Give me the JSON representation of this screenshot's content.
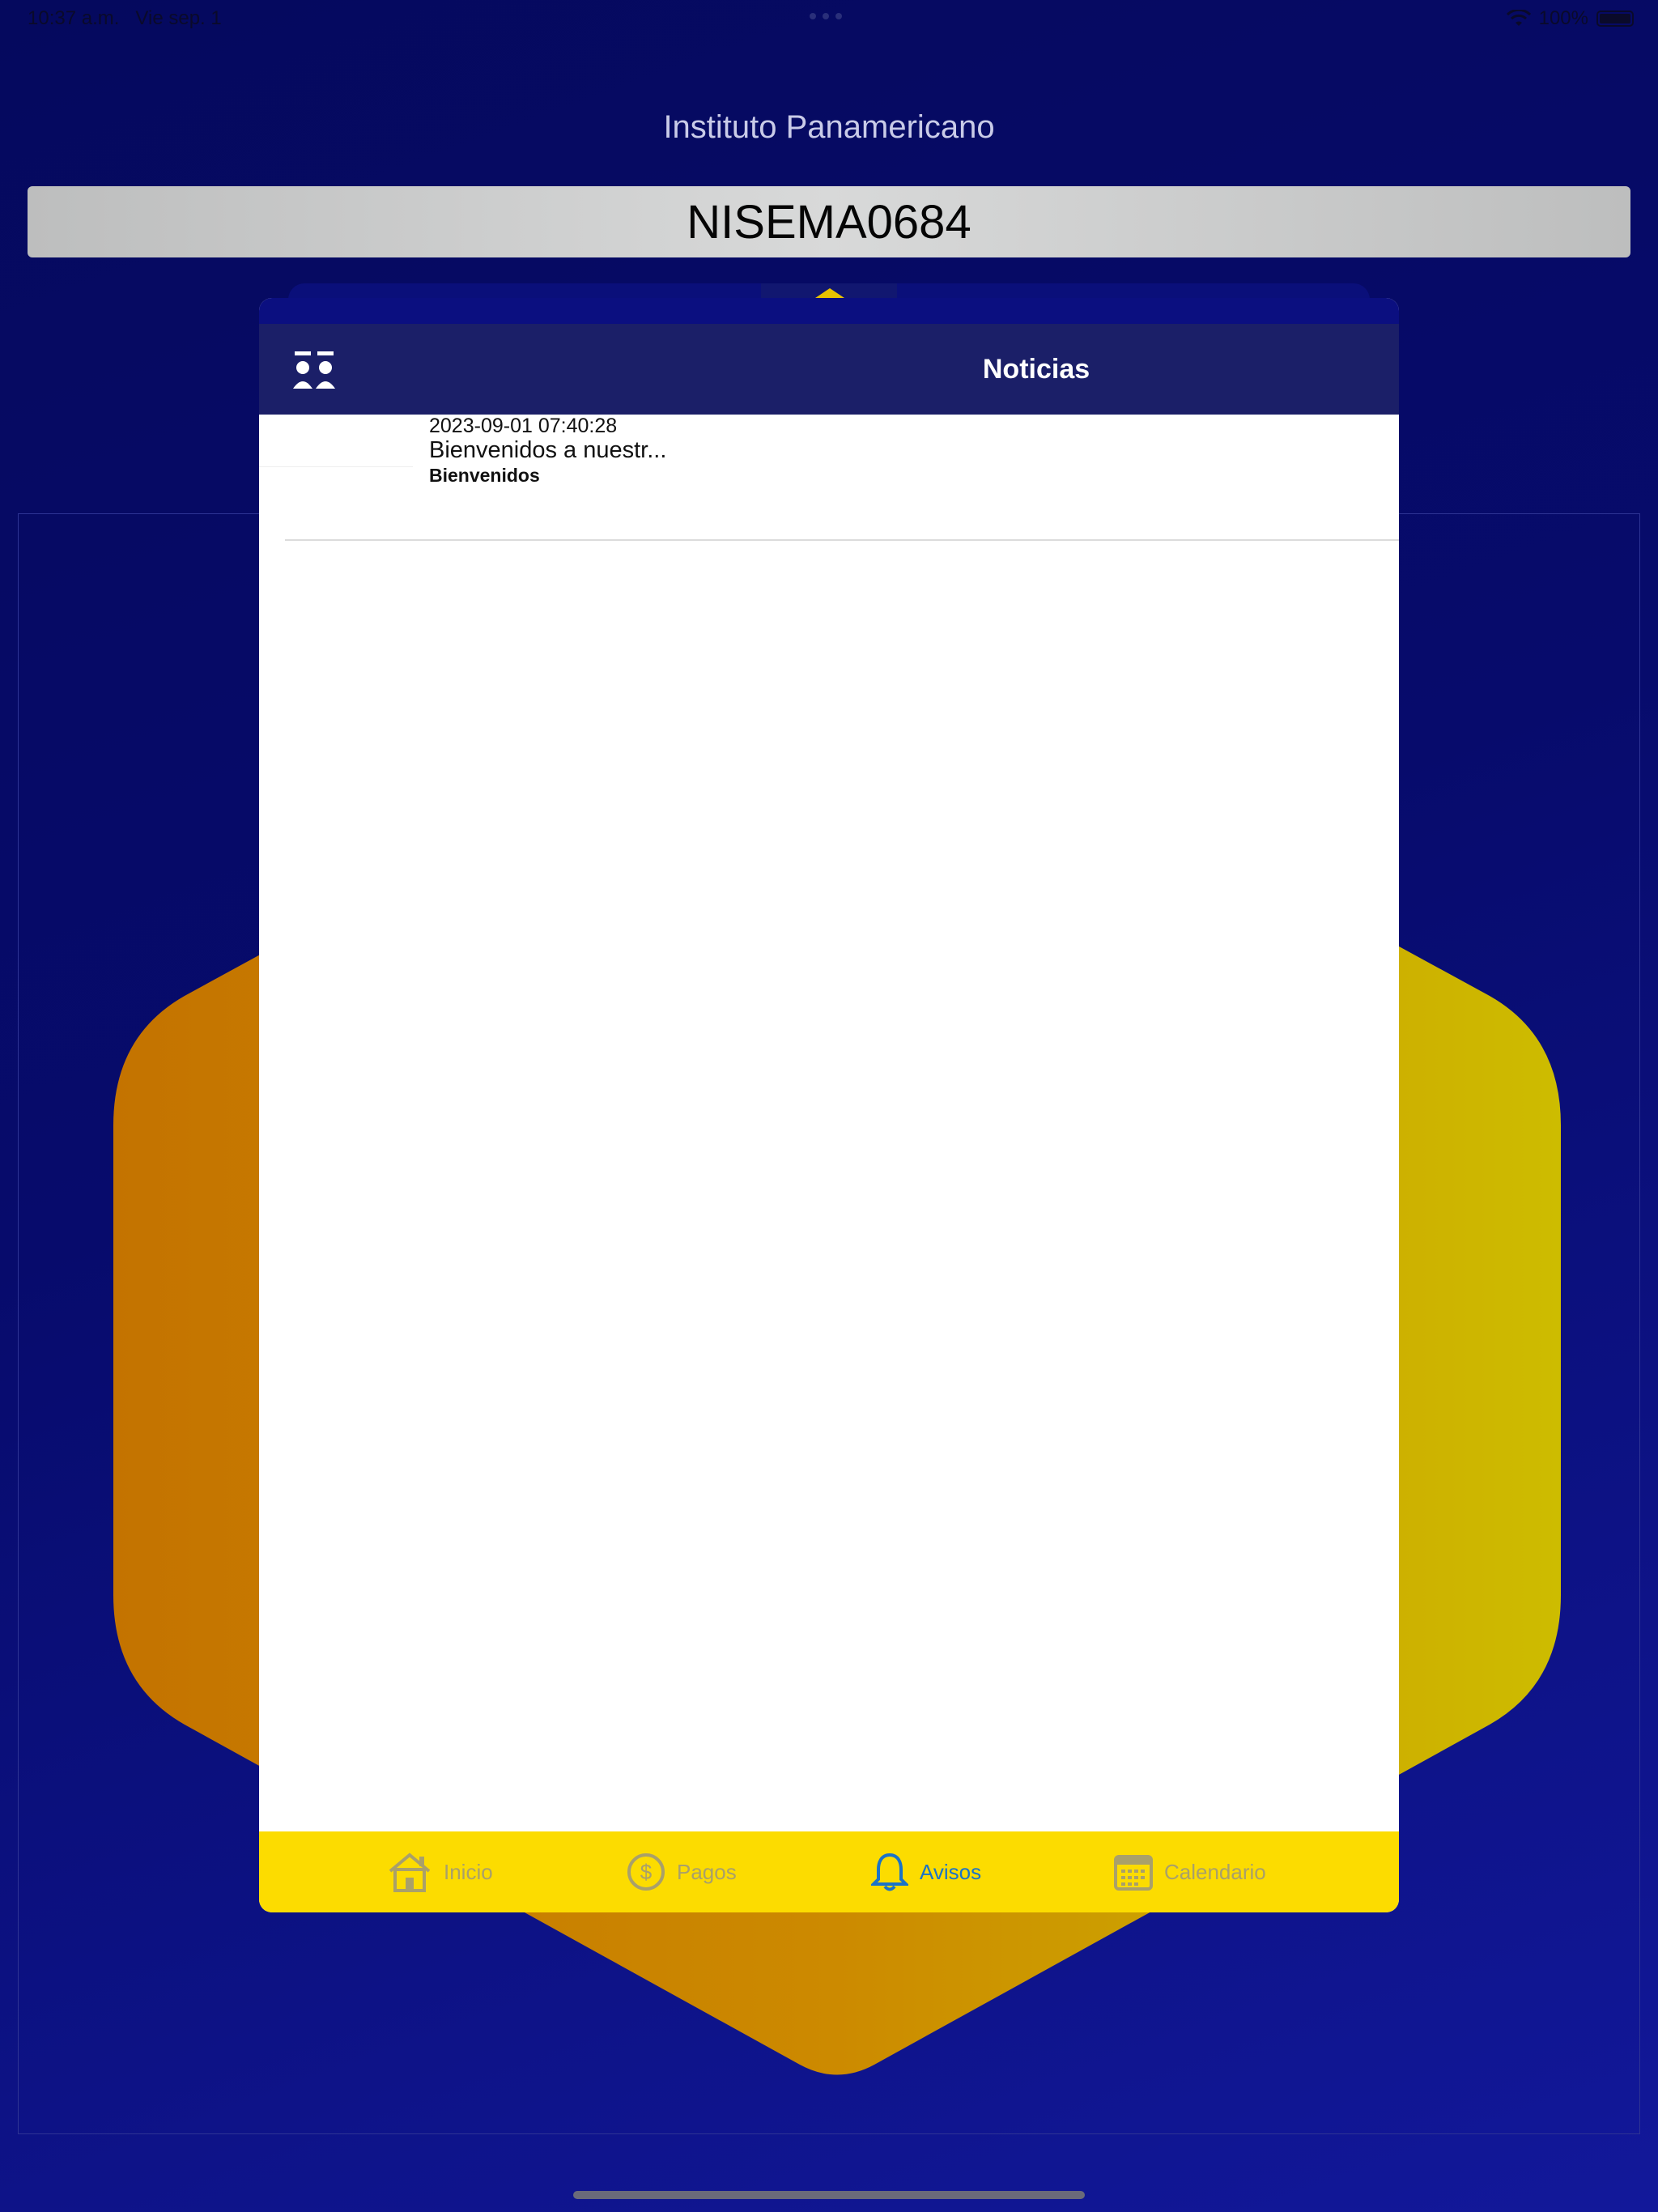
{
  "status_bar": {
    "time": "10:37 a.m.",
    "date": "Vie sep. 1",
    "battery": "100%",
    "icons": [
      "wifi-icon",
      "battery-icon"
    ]
  },
  "header": {
    "school_name": "Instituto Panamericano",
    "student_code": "NISEMA0684"
  },
  "modal": {
    "title": "Noticias",
    "header_icon": "students-icon",
    "news": [
      {
        "date": "2023-09-01 07:40:28",
        "title": "Bienvenidos a nuestr...",
        "subtitle": "Bienvenidos"
      }
    ]
  },
  "tabbar": {
    "tabs": [
      {
        "label": "Inicio",
        "icon": "home-icon",
        "active": false
      },
      {
        "label": "Pagos",
        "icon": "dollar-icon",
        "active": false
      },
      {
        "label": "Avisos",
        "icon": "bell-icon",
        "active": true
      },
      {
        "label": "Calendario",
        "icon": "calendar-icon",
        "active": false
      }
    ]
  },
  "colors": {
    "background": "#070b6c",
    "modal_header": "#1b1f68",
    "tabbar": "#fcdc00",
    "tab_active": "#1a73c8",
    "tab_inactive": "#a9a06a",
    "hexagon_left": "#c77a00",
    "hexagon_right": "#d0b800"
  }
}
